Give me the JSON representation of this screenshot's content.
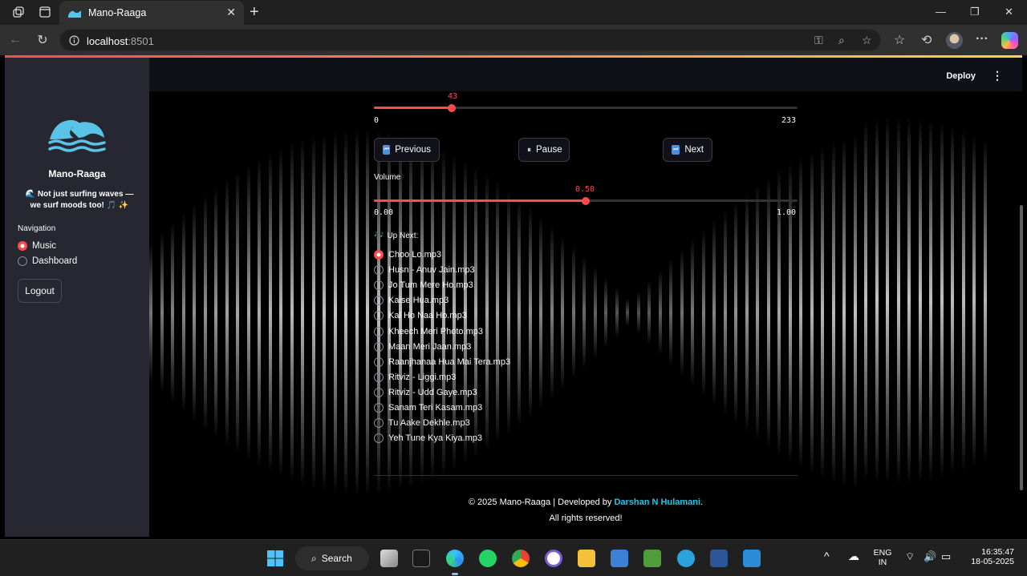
{
  "browser": {
    "tab_title": "Mano-Raaga",
    "url_host": "localhost",
    "url_port": ":8501"
  },
  "header": {
    "deploy_label": "Deploy",
    "menu_label": "⋮"
  },
  "sidebar": {
    "app_name": "Mano-Raaga",
    "tagline": "🌊 Not just surfing waves — we surf moods too! 🎵 ✨",
    "nav_label": "Navigation",
    "nav_items": [
      {
        "label": "Music",
        "selected": true
      },
      {
        "label": "Dashboard",
        "selected": false
      }
    ],
    "logout_label": "Logout"
  },
  "player": {
    "position": {
      "value": "43",
      "min": "0",
      "max": "233",
      "fraction": 0.1845
    },
    "previous_label": "Previous",
    "pause_label": "Pause",
    "next_label": "Next",
    "volume": {
      "label": "Volume",
      "value": "0.50",
      "min": "0.00",
      "max": "1.00",
      "fraction": 0.5
    },
    "up_next_label": "Up Next:",
    "songs": [
      "Choo Lo.mp3",
      "Husn - Anuv Jain.mp3",
      "Jo Tum Mere Ho.mp3",
      "Kaise Hua.mp3",
      "Kal Ho Naa Ho.mp3",
      "Kheech Meri Photo.mp3",
      "Maan Meri Jaan.mp3",
      "Raanjhanaa Hua Mai Tera.mp3",
      "Ritviz - Liggi.mp3",
      "Ritviz - Udd Gaye.mp3",
      "Sanam Teri Kasam.mp3",
      "Tu Aake Dekhle.mp3",
      "Yeh Tune Kya Kiya.mp3"
    ],
    "selected_song_index": 0
  },
  "footer": {
    "prefix": "© 2025 Mano-Raaga | Developed by ",
    "developer": "Darshan N Hulamani",
    "suffix": ".",
    "line2": "All rights reserved!"
  },
  "taskbar": {
    "search_label": "Search",
    "lang_line1": "ENG",
    "lang_line2": "IN",
    "time": "16:35:47",
    "date": "18-05-2025"
  },
  "colors": {
    "accent": "#ff4b4b",
    "developer_link": "#1ec8e6",
    "sidebar_bg": "#262730"
  }
}
